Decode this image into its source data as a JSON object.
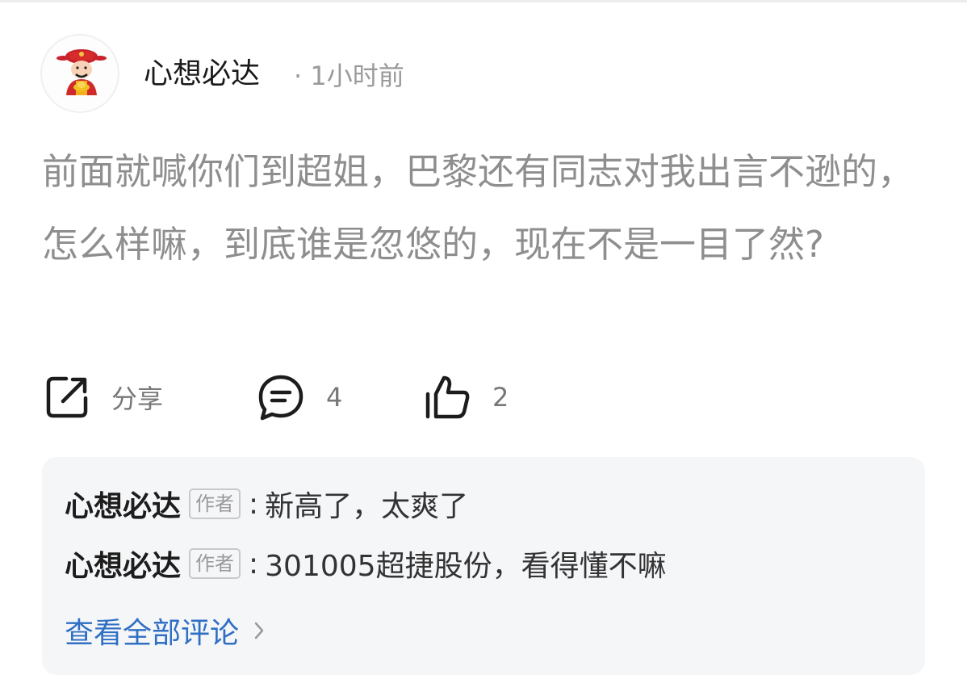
{
  "post": {
    "author": "心想必达",
    "time": "· 1小时前",
    "content": "前面就喊你们到超姐，巴黎还有同志对我出言不逊的，怎么样嘛，到底谁是忽悠的，现在不是一目了然?"
  },
  "actions": {
    "share_label": "分享",
    "comment_count": "4",
    "like_count": "2"
  },
  "comments": {
    "items": [
      {
        "author": "心想必达",
        "tag": "作者",
        "colon": ":",
        "text": "新高了，太爽了"
      },
      {
        "author": "心想必达",
        "tag": "作者",
        "colon": ":",
        "text": "301005超捷股份，看得懂不嘛"
      }
    ],
    "view_all": "查看全部评论"
  },
  "colors": {
    "accent_link": "#2f6fc4",
    "post_text": "#8e8e8e",
    "comment_bg": "#f5f6f8"
  },
  "icons": [
    "god-of-wealth-avatar",
    "share-icon",
    "comment-icon",
    "like-icon",
    "chevron-right-icon"
  ]
}
